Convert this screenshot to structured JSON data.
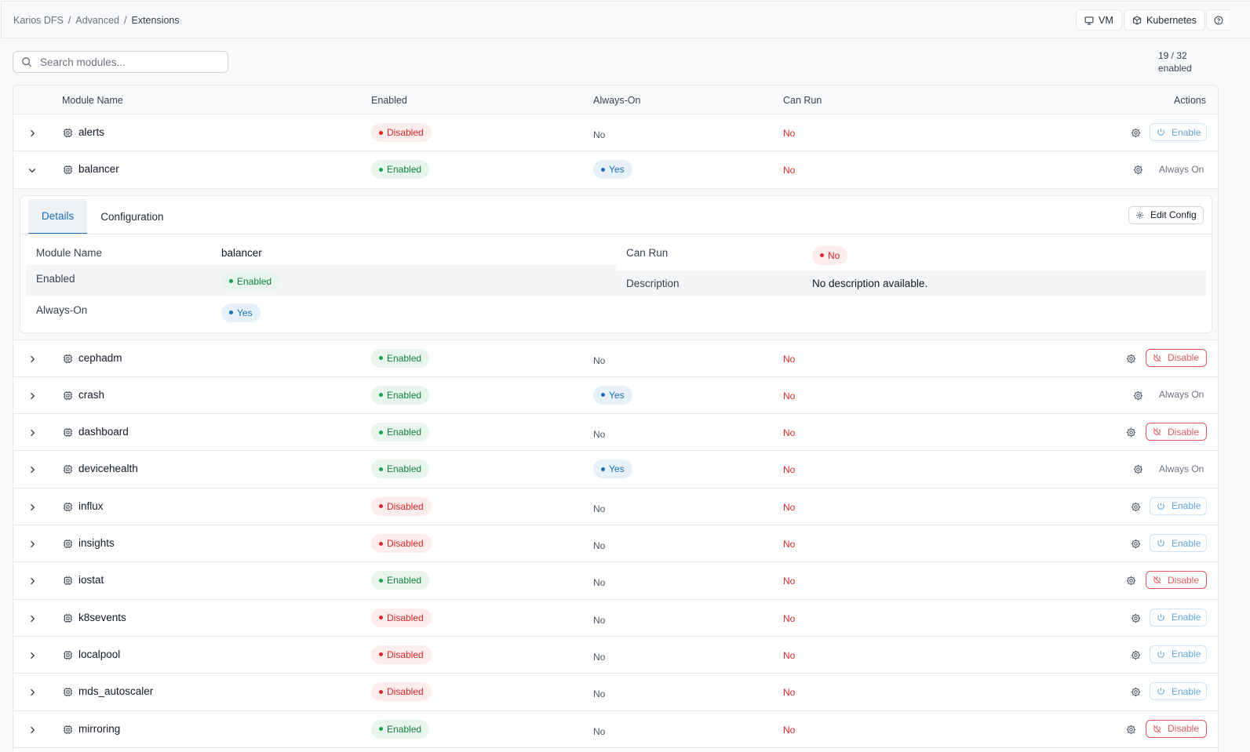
{
  "breadcrumb": [
    "Karios DFS",
    "Advanced",
    "Extensions"
  ],
  "breadcrumb_sep": "/",
  "topbar": {
    "vm_label": "VM",
    "kubernetes_label": "Kubernetes"
  },
  "search": {
    "placeholder": "Search modules..."
  },
  "summary": {
    "count": "19 / 32",
    "suffix": "enabled"
  },
  "columns": {
    "name": "Module Name",
    "enabled": "Enabled",
    "always_on": "Always-On",
    "can_run": "Can Run",
    "actions": "Actions"
  },
  "labels": {
    "enabled": "Enabled",
    "disabled": "Disabled",
    "yes": "Yes",
    "no": "No",
    "enable": "Enable",
    "disable": "Disable",
    "always_on": "Always On"
  },
  "details": {
    "tabs": [
      "Details",
      "Configuration"
    ],
    "edit_config": "Edit Config",
    "module_name_label": "Module Name",
    "module_name_value": "balancer",
    "enabled_label": "Enabled",
    "enabled_value": "Enabled",
    "always_on_label": "Always-On",
    "always_on_value": "Yes",
    "can_run_label": "Can Run",
    "can_run_value": "No",
    "description_label": "Description",
    "description_value": "No description available."
  },
  "modules": [
    {
      "name": "alerts",
      "enabled": "Disabled",
      "always_on": "No",
      "can_run": "No",
      "action": "Enable"
    },
    {
      "name": "balancer",
      "enabled": "Enabled",
      "always_on": "Yes",
      "can_run": "No",
      "action": "Always On",
      "expanded": true
    },
    {
      "name": "cephadm",
      "enabled": "Enabled",
      "always_on": "No",
      "can_run": "No",
      "action": "Disable"
    },
    {
      "name": "crash",
      "enabled": "Enabled",
      "always_on": "Yes",
      "can_run": "No",
      "action": "Always On"
    },
    {
      "name": "dashboard",
      "enabled": "Enabled",
      "always_on": "No",
      "can_run": "No",
      "action": "Disable"
    },
    {
      "name": "devicehealth",
      "enabled": "Enabled",
      "always_on": "Yes",
      "can_run": "No",
      "action": "Always On"
    },
    {
      "name": "influx",
      "enabled": "Disabled",
      "always_on": "No",
      "can_run": "No",
      "action": "Enable"
    },
    {
      "name": "insights",
      "enabled": "Disabled",
      "always_on": "No",
      "can_run": "No",
      "action": "Enable"
    },
    {
      "name": "iostat",
      "enabled": "Enabled",
      "always_on": "No",
      "can_run": "No",
      "action": "Disable"
    },
    {
      "name": "k8sevents",
      "enabled": "Disabled",
      "always_on": "No",
      "can_run": "No",
      "action": "Enable"
    },
    {
      "name": "localpool",
      "enabled": "Disabled",
      "always_on": "No",
      "can_run": "No",
      "action": "Enable"
    },
    {
      "name": "mds_autoscaler",
      "enabled": "Disabled",
      "always_on": "No",
      "can_run": "No",
      "action": "Enable"
    },
    {
      "name": "mirroring",
      "enabled": "Enabled",
      "always_on": "No",
      "can_run": "No",
      "action": "Disable"
    }
  ]
}
